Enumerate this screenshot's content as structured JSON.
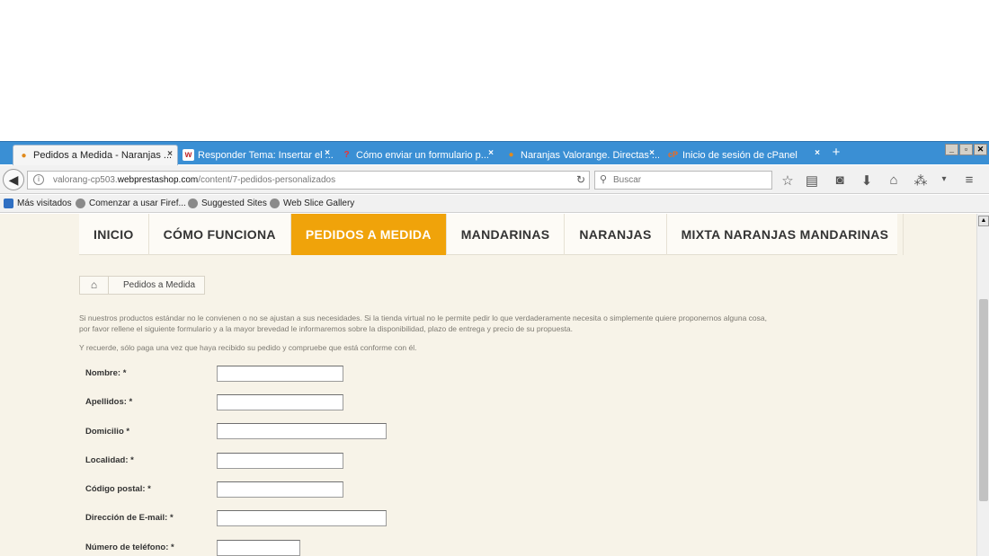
{
  "browser": {
    "tabs": [
      {
        "label": "Pedidos a Medida - Naranjas ...",
        "favicon": "orange-leaf-icon",
        "active": true
      },
      {
        "label": "Responder Tema: Insertar el ...",
        "favicon": "w-icon",
        "active": false
      },
      {
        "label": "Cómo enviar un formulario p...",
        "favicon": "question-icon",
        "active": false
      },
      {
        "label": "Naranjas Valorange. Directas ...",
        "favicon": "orange-leaf-icon",
        "active": false
      },
      {
        "label": "Inicio de sesión de cPanel",
        "favicon": "cpanel-icon",
        "active": false
      }
    ],
    "new_tab": "+",
    "window_buttons": [
      "_",
      "▫",
      "✕"
    ],
    "url": {
      "prefix": "valorang-cp503.",
      "domain": "webprestashop.com",
      "path": "/content/7-pedidos-personalizados"
    },
    "search_placeholder": "Buscar",
    "bookmarks": [
      {
        "label": "Más visitados"
      },
      {
        "label": "Comenzar a usar Firef..."
      },
      {
        "label": "Suggested Sites"
      },
      {
        "label": "Web Slice Gallery"
      }
    ]
  },
  "site": {
    "menu": [
      {
        "label": "INICIO",
        "active": false
      },
      {
        "label": "CÓMO FUNCIONA",
        "active": false
      },
      {
        "label": "PEDIDOS A MEDIDA",
        "active": true
      },
      {
        "label": "MANDARINAS",
        "active": false
      },
      {
        "label": "NARANJAS",
        "active": false
      },
      {
        "label": "MIXTA NARANJAS MANDARINAS",
        "active": false
      }
    ],
    "breadcrumb": "Pedidos a Medida",
    "intro_line1": "Si nuestros productos estándar no le convienen o no se ajustan a sus necesidades. Si la tienda virtual no le permite pedir lo que verdaderamente necesita o simplemente quiere proponernos alguna cosa,",
    "intro_line2": "por favor rellene el siguiente formulario y a la mayor brevedad le informaremos sobre la disponibilidad, plazo de entrega y precio de su propuesta.",
    "intro_line3": "Y recuerde, sólo paga una vez que haya recibido su pedido y compruebe que está conforme con él.",
    "form": {
      "fields": [
        {
          "label": "Nombre: *",
          "value": ""
        },
        {
          "label": "Apellidos: *",
          "value": ""
        },
        {
          "label": "Domicilio *",
          "value": ""
        },
        {
          "label": "Localidad: *",
          "value": ""
        },
        {
          "label": "Código postal: *",
          "value": ""
        },
        {
          "label": "Dirección de E-mail: *",
          "value": ""
        },
        {
          "label": "Número de teléfono: *",
          "value": ""
        }
      ]
    }
  },
  "colors": {
    "tabstrip": "#3a8fd4",
    "menu_active": "#f0a30a",
    "page_bg": "#f7f3e8"
  }
}
